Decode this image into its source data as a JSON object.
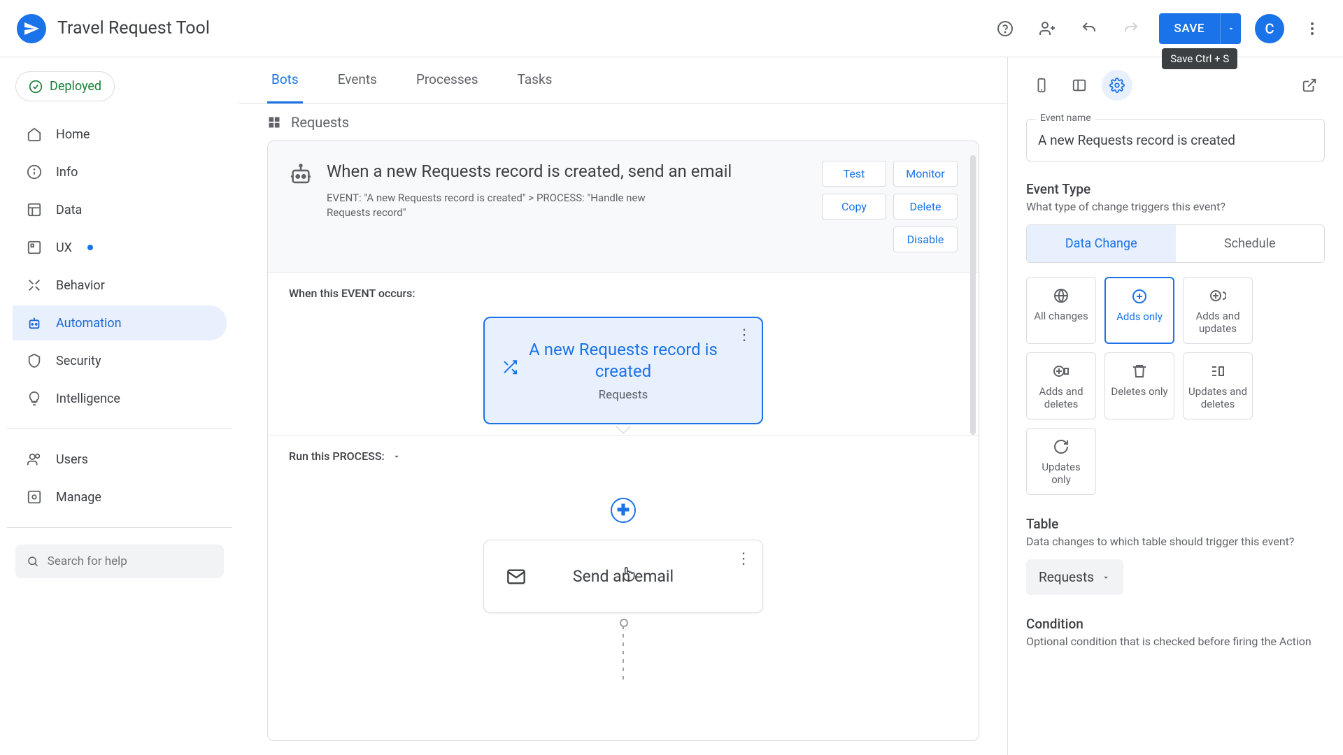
{
  "app_title": "Travel Request Tool",
  "top": {
    "save": "SAVE",
    "save_tooltip": "Save Ctrl + S",
    "avatar_initial": "C"
  },
  "sidebar": {
    "deployed": "Deployed",
    "items": [
      "Home",
      "Info",
      "Data",
      "UX",
      "Behavior",
      "Automation",
      "Security",
      "Intelligence"
    ],
    "items2": [
      "Users",
      "Manage"
    ],
    "search_placeholder": "Search for help"
  },
  "tabs": [
    "Bots",
    "Events",
    "Processes",
    "Tasks"
  ],
  "breadcrumb": "Requests",
  "bot": {
    "title": "When a new Requests record is created, send an email",
    "sub": "EVENT: \"A new Requests record is created\" > PROCESS: \"Handle new Requests record\"",
    "actions": [
      "Test",
      "Monitor",
      "Copy",
      "Delete",
      "Disable"
    ],
    "event_label": "When this EVENT occurs:",
    "event_title": "A new Requests record is created",
    "event_sub": "Requests",
    "process_label": "Run this PROCESS:",
    "step_title": "Send an email"
  },
  "right": {
    "event_name_label": "Event name",
    "event_name_value": "A new Requests record is created",
    "event_type_title": "Event Type",
    "event_type_desc": "What type of change triggers this event?",
    "seg": [
      "Data Change",
      "Schedule"
    ],
    "triggers": [
      "All changes",
      "Adds only",
      "Adds and updates",
      "Adds and deletes",
      "Deletes only",
      "Updates and deletes",
      "Updates only"
    ],
    "table_title": "Table",
    "table_desc": "Data changes to which table should trigger this event?",
    "table_value": "Requests",
    "condition_title": "Condition",
    "condition_desc": "Optional condition that is checked before firing the Action"
  }
}
